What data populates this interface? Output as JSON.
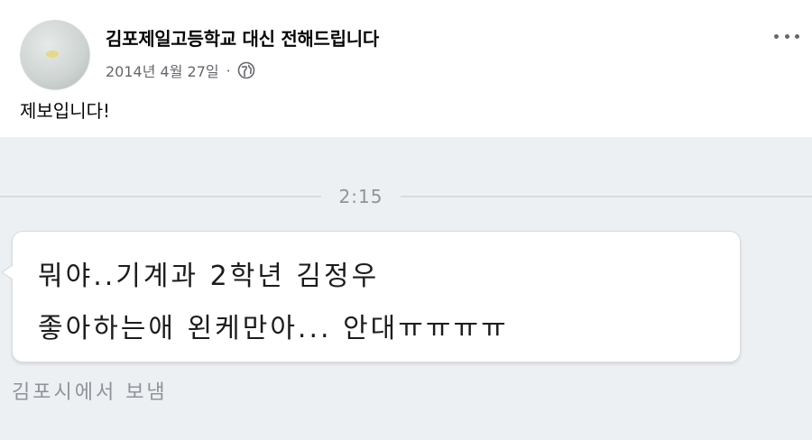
{
  "post": {
    "author": "김포제일고등학교 대신 전해드립니다",
    "date": "2014년 4월 27일",
    "separator": "·",
    "privacy_icon": "globe-icon",
    "more_icon": "more-options-icon",
    "caption": "제보입니다!"
  },
  "screenshot": {
    "timestamp": "2:15",
    "message_lines": [
      "뭐야..기계과 2학년 김정우",
      "좋아하는애 왼케만아... 안대ㅠㅠㅠㅠ"
    ],
    "sender_note": "김포시에서 보냄"
  },
  "colors": {
    "author_text": "#050505",
    "meta_text": "#65676b",
    "chat_background": "#edf0f2",
    "bubble_background": "#ffffff"
  }
}
